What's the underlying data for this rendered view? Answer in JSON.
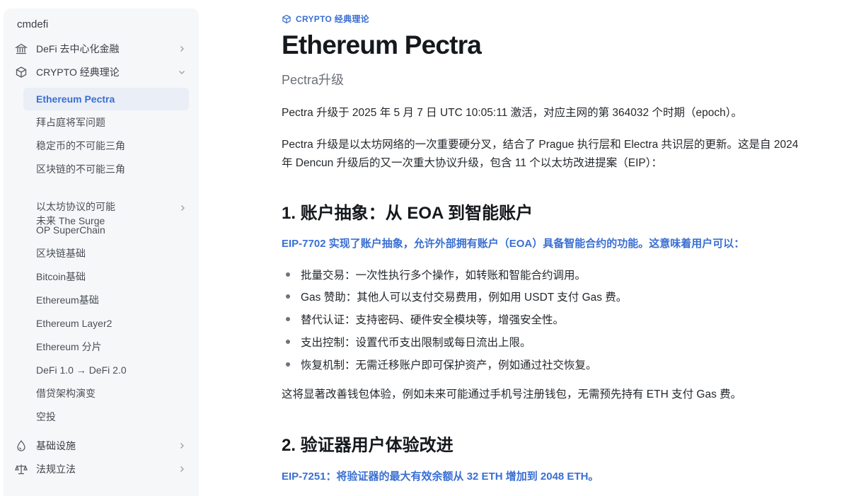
{
  "sidebar": {
    "site_title": "cmdefi",
    "groups": [
      {
        "label": "DeFi 去中心化金融",
        "icon": "bank-icon"
      },
      {
        "label": "CRYPTO 经典理论",
        "icon": "cube-icon"
      },
      {
        "label": "基础设施",
        "icon": "drop-icon"
      },
      {
        "label": "法规立法",
        "icon": "scales-icon"
      }
    ],
    "items": [
      {
        "label": "Ethereum Pectra"
      },
      {
        "label": "拜占庭将军问题"
      },
      {
        "label": "稳定币的不可能三角"
      },
      {
        "label": "区块链的不可能三角"
      },
      {
        "label": "以太坊协议的可能\n未来 The Surge"
      },
      {
        "label": "OP SuperChain"
      },
      {
        "label": "区块链基础"
      },
      {
        "label": "Bitcoin基础"
      },
      {
        "label": "Ethereum基础"
      },
      {
        "label": "Ethereum Layer2"
      },
      {
        "label": "Ethereum 分片"
      },
      {
        "label": "DeFi 1.0 → DeFi 2.0"
      },
      {
        "label": "借贷架构演变"
      },
      {
        "label": "空投"
      }
    ]
  },
  "main": {
    "breadcrumb": "CRYPTO 经典理论",
    "title": "Ethereum Pectra",
    "subtitle": "Pectra升级",
    "para1": "Pectra 升级于 2025 年 5 月 7 日 UTC 10:05:11 激活，对应主网的第 364032 个时期（epoch）。",
    "para2": "Pectra 升级是以太坊网络的一次重要硬分叉，结合了 Prague 执行层和 Electra 共识层的更新。这是自 2024 年 Dencun 升级后的又一次重大协议升级，包含 11 个以太坊改进提案（EIP）：",
    "section1": {
      "heading": "1. 账户抽象：从 EOA 到智能账户",
      "eip": "EIP-7702 实现了账户抽象，允许外部拥有账户（EOA）具备智能合约的功能。这意味着用户可以：",
      "bullets": [
        "批量交易：一次性执行多个操作，如转账和智能合约调用。",
        "Gas 赞助：其他人可以支付交易费用，例如用 USDT 支付 Gas 费。",
        "替代认证：支持密码、硬件安全模块等，增强安全性。",
        "支出控制：设置代币支出限制或每日流出上限。",
        "恢复机制：无需迁移账户即可保护资产，例如通过社交恢复。"
      ],
      "closing": "这将显著改善钱包体验，例如未来可能通过手机号注册钱包，无需预先持有 ETH 支付 Gas 费。"
    },
    "section2": {
      "heading": "2. 验证器用户体验改进",
      "eip": "EIP-7251：将验证器的最大有效余额从 32 ETH 增加到 2048 ETH。"
    }
  },
  "colors": {
    "accent": "#3a6fd2",
    "sidebar_bg": "#f6f7f9",
    "active_bg": "#eaeef6"
  }
}
